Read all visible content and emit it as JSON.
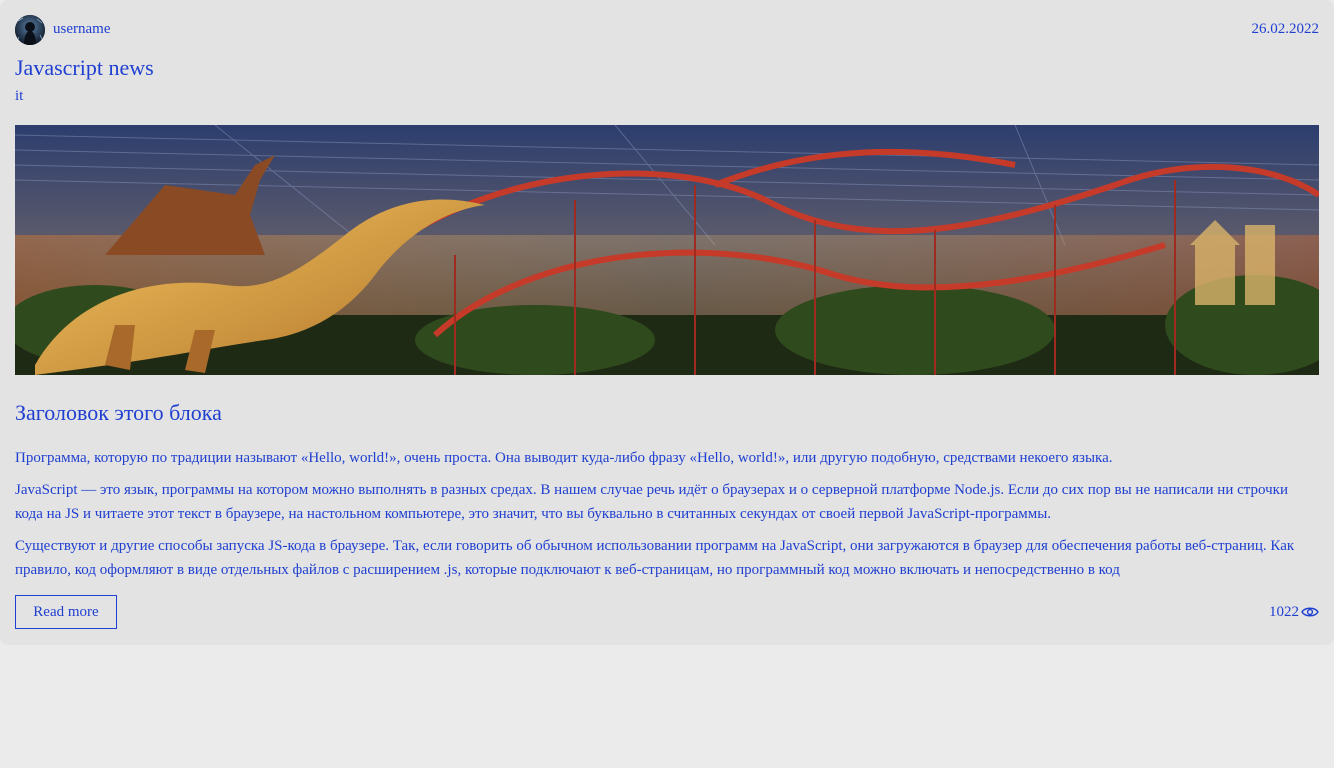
{
  "post": {
    "author": {
      "username": "username",
      "avatar_icon": "avatar-image"
    },
    "date": "26.02.2022",
    "title": "Javascript news",
    "tag": "it",
    "image_icon": "theme-park-photo",
    "block_title": "Заголовок этого блока",
    "paragraphs": [
      "Программа, которую по традиции называют «Hello, world!», очень проста. Она выводит куда-либо фразу «Hello, world!», или другую подобную, средствами некоего языка.",
      "JavaScript — это язык, программы на котором можно выполнять в разных средах. В нашем случае речь идёт о браузерах и о серверной платформе Node.js. Если до сих пор вы не написали ни строчки кода на JS и читаете этот текст в браузере, на настольном компьютере, это значит, что вы буквально в считанных секундах от своей первой JavaScript-программы.",
      "Существуют и другие способы запуска JS-кода в браузере. Так, если говорить об обычном использовании программ на JavaScript, они загружаются в браузер для обеспечения работы веб-страниц. Как правило, код оформляют в виде отдельных файлов с расширением .js, которые подключают к веб-страницам, но программный код можно включать и непосредственно в код"
    ],
    "read_more_label": "Read more",
    "views": "1022",
    "views_icon": "eye-icon"
  },
  "colors": {
    "link": "#1f3fd1",
    "card_background": "#e3e3e3",
    "page_background": "#ebebeb"
  }
}
